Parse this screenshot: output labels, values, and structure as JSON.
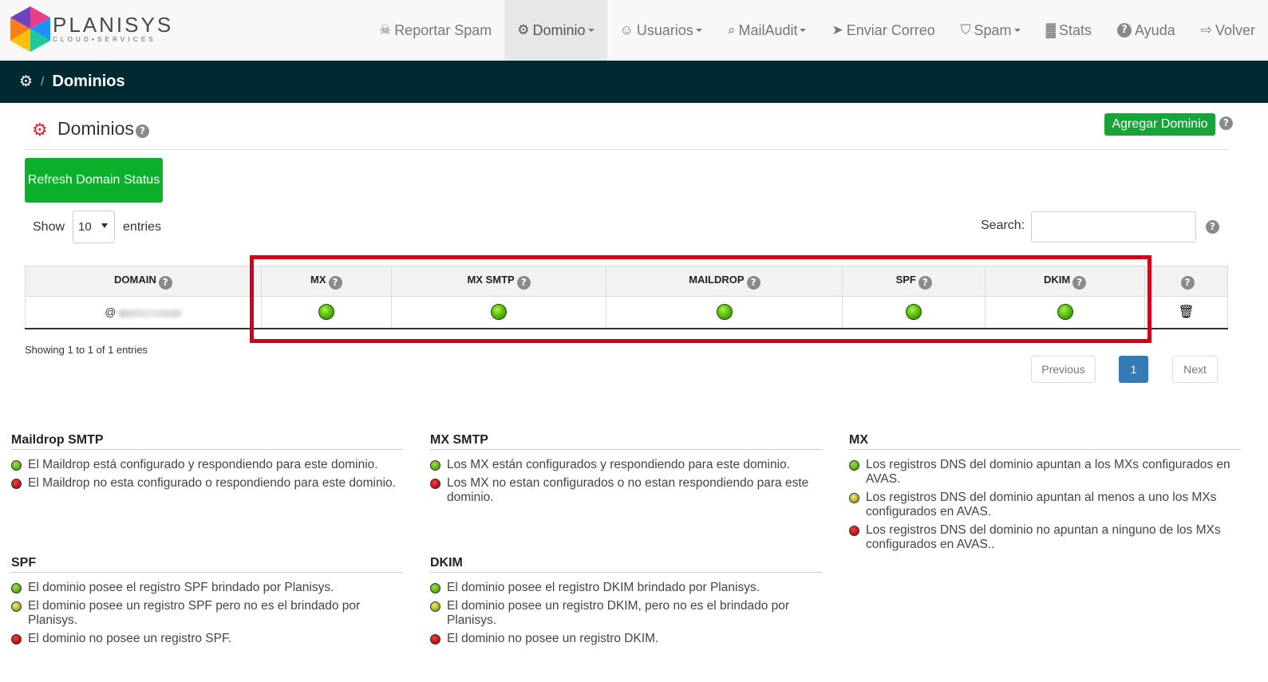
{
  "brand": {
    "name": "PLANISYS",
    "tagline": "CLOUD•SERVICES"
  },
  "nav": [
    {
      "label": "Reportar Spam",
      "icon": "spam-report-icon",
      "glyph": "☠",
      "caret": false,
      "active": false
    },
    {
      "label": "Dominio",
      "icon": "gear-icon",
      "glyph": "⚙",
      "caret": true,
      "active": true
    },
    {
      "label": "Usuarios",
      "icon": "user-icon",
      "glyph": "☺",
      "caret": true,
      "active": false
    },
    {
      "label": "MailAudit",
      "icon": "search-icon",
      "glyph": "⌕",
      "caret": true,
      "active": false
    },
    {
      "label": "Enviar Correo",
      "icon": "paper-plane-icon",
      "glyph": "➤",
      "caret": false,
      "active": false
    },
    {
      "label": "Spam",
      "icon": "shield-icon",
      "glyph": "⛉",
      "caret": true,
      "active": false
    },
    {
      "label": "Stats",
      "icon": "bar-chart-icon",
      "glyph": "▓",
      "caret": false,
      "active": false
    },
    {
      "label": "Ayuda",
      "icon": "question-circle-icon",
      "glyph": "?",
      "caret": false,
      "active": false
    },
    {
      "label": "Volver",
      "icon": "sign-in-icon",
      "glyph": "⇨",
      "caret": false,
      "active": false
    }
  ],
  "breadcrumb": {
    "separator": "/",
    "title": "Dominios"
  },
  "page": {
    "title": "Dominios",
    "add_button": "Agregar Dominio",
    "refresh_button": "Refresh Domain Status",
    "show_label": "Show",
    "entries_label": "entries",
    "page_size": "10",
    "search_label": "Search:",
    "search_value": ""
  },
  "table": {
    "columns": [
      "DOMAIN",
      "MX",
      "MX SMTP",
      "MAILDROP",
      "SPF",
      "DKIM"
    ],
    "rows": [
      {
        "domain_prefix": "@",
        "mx": "green",
        "mx_smtp": "green",
        "maildrop": "green",
        "spf": "green",
        "dkim": "green"
      }
    ]
  },
  "info": "Showing 1 to 1 of 1 entries",
  "pagination": {
    "previous": "Previous",
    "current": "1",
    "next": "Next"
  },
  "colors": {
    "green": "#4caf10",
    "red": "#c00000",
    "yellow": "#c8c31a",
    "highlight": "#d0021b",
    "button_green": "#0db02b",
    "header_dark": "#012932"
  },
  "legend": {
    "maildrop": {
      "title": "Maildrop SMTP",
      "items": [
        {
          "status": "green",
          "text": "El Maildrop está configurado y respondiendo para este dominio."
        },
        {
          "status": "red",
          "text": "El Maildrop no esta configurado o respondiendo para este dominio."
        }
      ]
    },
    "mx_smtp": {
      "title": "MX SMTP",
      "items": [
        {
          "status": "green",
          "text": "Los MX están configurados y respondiendo para este dominio."
        },
        {
          "status": "red",
          "text": "Los MX no estan configurados o no estan respondiendo para este dominio."
        }
      ]
    },
    "mx": {
      "title": "MX",
      "items": [
        {
          "status": "green",
          "text": "Los registros DNS del dominio apuntan a los MXs configurados en AVAS."
        },
        {
          "status": "yellow",
          "text": "Los registros DNS del dominio apuntan al menos a uno los MXs configurados en AVAS."
        },
        {
          "status": "red",
          "text": "Los registros DNS del dominio no apuntan a ninguno de los MXs configurados en AVAS.."
        }
      ]
    },
    "spf": {
      "title": "SPF",
      "items": [
        {
          "status": "green",
          "text": "El dominio posee el registro SPF brindado por Planisys."
        },
        {
          "status": "yellow",
          "text": "El dominio posee un registro SPF pero no es el brindado por Planisys."
        },
        {
          "status": "red",
          "text": "El dominio no posee un registro SPF."
        }
      ]
    },
    "dkim": {
      "title": "DKIM",
      "items": [
        {
          "status": "green",
          "text": "El dominio posee el registro DKIM brindado por Planisys."
        },
        {
          "status": "yellow",
          "text": "El dominio posee un registro DKIM, pero no es el brindado por Planisys."
        },
        {
          "status": "red",
          "text": "El dominio no posee un registro DKIM."
        }
      ]
    }
  }
}
